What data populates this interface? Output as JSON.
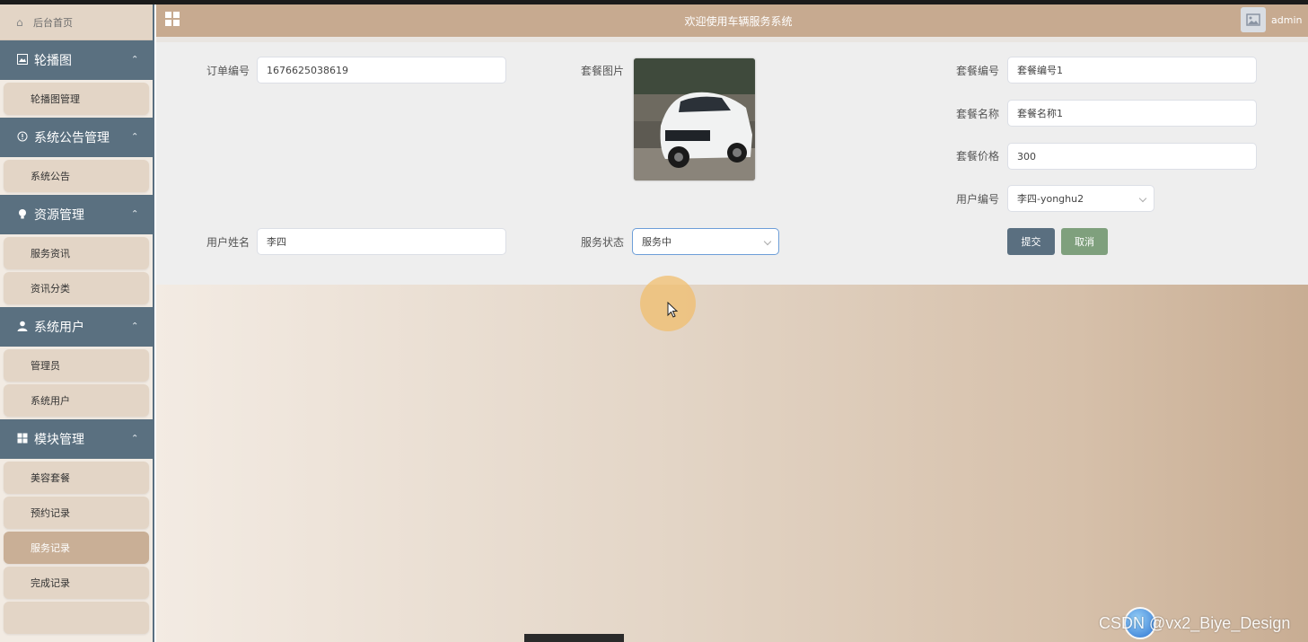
{
  "header": {
    "title": "欢迎使用车辆服务系统",
    "user": "admin"
  },
  "sidebar": {
    "home": "后台首页",
    "groups": [
      {
        "title": "轮播图",
        "icon": "image-icon",
        "items": [
          "轮播图管理"
        ]
      },
      {
        "title": "系统公告管理",
        "icon": "info-circle-icon",
        "items": [
          "系统公告"
        ]
      },
      {
        "title": "资源管理",
        "icon": "lightbulb-icon",
        "items": [
          "服务资讯",
          "资讯分类"
        ]
      },
      {
        "title": "系统用户",
        "icon": "user-icon",
        "items": [
          "管理员",
          "系统用户"
        ]
      },
      {
        "title": "模块管理",
        "icon": "grid-icon",
        "items": [
          "美容套餐",
          "预约记录",
          "服务记录",
          "完成记录"
        ]
      }
    ],
    "active_item": "服务记录"
  },
  "form": {
    "order_no_label": "订单编号",
    "order_no_value": "1676625038619",
    "image_label": "套餐图片",
    "package_no_label": "套餐编号",
    "package_no_value": "套餐编号1",
    "package_name_label": "套餐名称",
    "package_name_value": "套餐名称1",
    "price_label": "套餐价格",
    "price_value": "300",
    "user_no_label": "用户编号",
    "user_no_value": "李四-yonghu2",
    "user_name_label": "用户姓名",
    "user_name_value": "李四",
    "status_label": "服务状态",
    "status_value": "服务中",
    "submit": "提交",
    "cancel": "取消"
  },
  "watermark": "CSDN @vx2_Biye_Design"
}
